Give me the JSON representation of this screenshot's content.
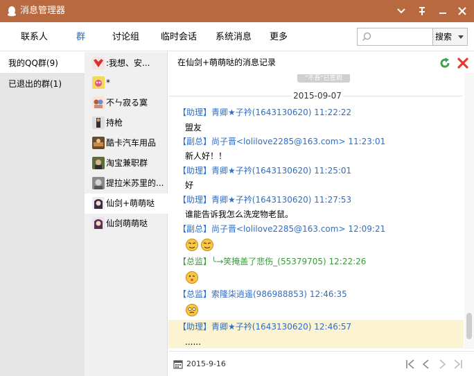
{
  "window": {
    "title": "消息管理器",
    "titlebar_color": "#b8693f",
    "controls": [
      "chevron-down-icon",
      "pin-icon",
      "minimize-icon",
      "close-icon"
    ]
  },
  "nav": {
    "tabs": [
      "联系人",
      "群",
      "讨论组",
      "临时会话",
      "系统消息",
      "更多"
    ],
    "active_tab": "群",
    "search": {
      "placeholder": "",
      "button_label": "搜索"
    }
  },
  "left_nav": {
    "items": [
      {
        "label": "我的QQ群(9)",
        "selected": true
      },
      {
        "label": "已退出的群(1)",
        "selected": false
      }
    ]
  },
  "groups": [
    {
      "name": ":我想、安...",
      "selected": false
    },
    {
      "name": "*",
      "selected": false
    },
    {
      "name": "不ㄣ寂る寞",
      "selected": false
    },
    {
      "name": "持枪",
      "selected": false
    },
    {
      "name": "酷卡汽车用品",
      "selected": false
    },
    {
      "name": "淘宝兼职群",
      "selected": false
    },
    {
      "name": "提拉米苏里的...",
      "selected": false
    },
    {
      "name": "仙剑+萌萌哒",
      "selected": true
    },
    {
      "name": "仙剑萌萌哒",
      "selected": false
    }
  ],
  "history": {
    "title": "在仙剑+萌萌哒的消息记录",
    "torn_label": "\"不吾\"已签到",
    "date": "2015-09-07",
    "messages": [
      {
        "header": "【助理】青卿★子衿(1643130620) 11:22:22",
        "body": "盟友"
      },
      {
        "header": "【副总】尚子晋<lolilove2285@163.com> 11:23:01",
        "body": "新人好！！"
      },
      {
        "header": "【助理】青卿★子衿(1643130620) 11:25:01",
        "body": "好"
      },
      {
        "header": "【助理】青卿★子衿(1643130620) 11:27:53",
        "body": "谁能告诉我怎么洗宠物老鼠。"
      },
      {
        "header": "【副总】尚子晋<lolilove2285@163.com> 12:09:21",
        "body": ""
      },
      {
        "header": "【总监】╰→笑掩盖了悲伤_(55379705) 12:22:26",
        "body": ""
      },
      {
        "header": "【总监】索隆柒逍遥(986988853) 12:46:35",
        "body": ""
      },
      {
        "header": "【助理】青卿★子衿(1643130620) 12:46:57",
        "body": "......"
      }
    ],
    "highlight_color": "#fbf3d2",
    "header_color": "#2f6ec5"
  },
  "footer": {
    "date": "2015-9-16",
    "pager_icons": [
      "first-page-icon",
      "prev-page-icon",
      "next-page-icon",
      "last-page-icon"
    ]
  }
}
